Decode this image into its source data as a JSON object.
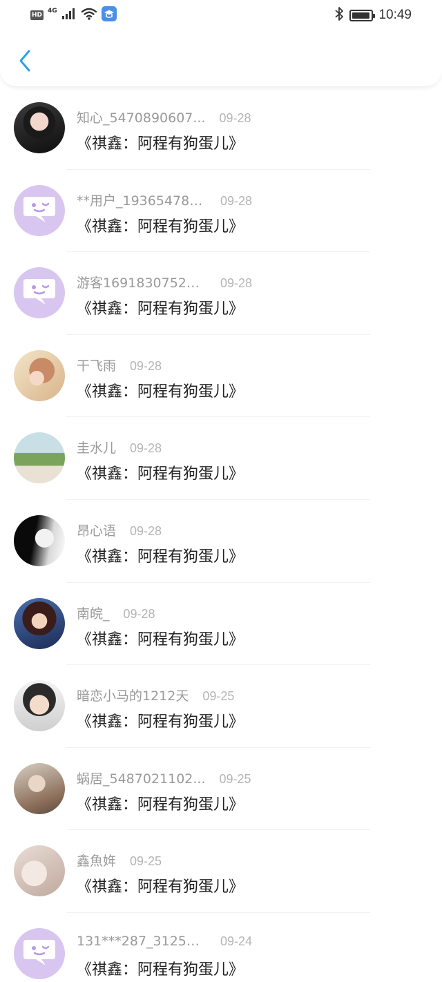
{
  "status_bar": {
    "hd_label": "HD",
    "network_label": "4G",
    "time": "10:49",
    "battery_level": 0.95
  },
  "header": {
    "back_icon": "chevron-left-icon",
    "accent_color": "#29a3e6"
  },
  "items": [
    {
      "name": "知心_5470890607...",
      "date": "09-28",
      "message": "《祺鑫：阿程有狗蛋儿》",
      "avatar": "photo"
    },
    {
      "name": "**用户_193654785...",
      "date": "09-28",
      "message": "《祺鑫：阿程有狗蛋儿》",
      "avatar": "default"
    },
    {
      "name": "游客16918307522...",
      "date": "09-28",
      "message": "《祺鑫：阿程有狗蛋儿》",
      "avatar": "default"
    },
    {
      "name": "干飞雨",
      "date": "09-28",
      "message": "《祺鑫：阿程有狗蛋儿》",
      "avatar": "photo"
    },
    {
      "name": "圭水儿",
      "date": "09-28",
      "message": "《祺鑫：阿程有狗蛋儿》",
      "avatar": "photo"
    },
    {
      "name": "昂心语",
      "date": "09-28",
      "message": "《祺鑫：阿程有狗蛋儿》",
      "avatar": "photo"
    },
    {
      "name": "南皖_",
      "date": "09-28",
      "message": "《祺鑫：阿程有狗蛋儿》",
      "avatar": "photo"
    },
    {
      "name": "暗恋小马的1212天",
      "date": "09-25",
      "message": "《祺鑫：阿程有狗蛋儿》",
      "avatar": "photo"
    },
    {
      "name": "蜗居_5487021102...",
      "date": "09-25",
      "message": "《祺鑫：阿程有狗蛋儿》",
      "avatar": "photo"
    },
    {
      "name": "鑫魚姩",
      "date": "09-25",
      "message": "《祺鑫：阿程有狗蛋儿》",
      "avatar": "photo"
    },
    {
      "name": "131***287_31252...",
      "date": "09-24",
      "message": "《祺鑫：阿程有狗蛋儿》",
      "avatar": "default"
    }
  ]
}
